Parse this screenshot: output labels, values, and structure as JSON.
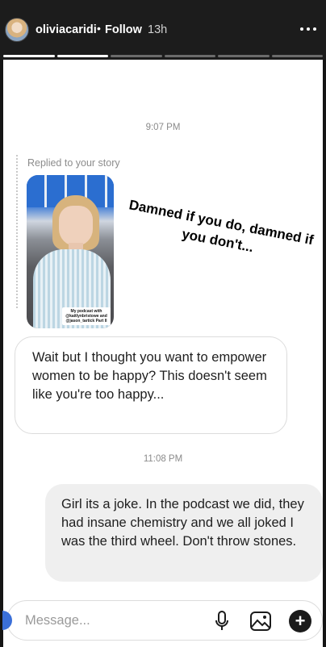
{
  "story_header": {
    "username": "oliviacaridi",
    "separator": "•",
    "follow_label": "Follow",
    "time_ago": "13h",
    "progress_segments": 6,
    "progress_completed": 2
  },
  "conversation": {
    "time_1": "9:07 PM",
    "replied_label": "Replied to your story",
    "story_caption": "My podcast with @kaitlynbristowe and @jason_tartick Part II",
    "sticker_text": "Damned if you do, damned if you don't...",
    "incoming_message": "Wait but I thought you want to empower women to be happy? This doesn't seem like you're too happy...",
    "time_2": "11:08 PM",
    "outgoing_message": "Girl its a joke. In the podcast we did, they had insane chemistry and we all joked I was the third wheel. Don't throw stones."
  },
  "composer": {
    "placeholder": "Message...",
    "icons": [
      "microphone-icon",
      "gallery-icon",
      "plus-icon"
    ],
    "plus_glyph": "+"
  },
  "colors": {
    "sheet_bg": "#ffffff",
    "outgoing_bubble": "#efefef",
    "story_bar": "#1c1c1c",
    "accent": "#3a6fd8"
  }
}
